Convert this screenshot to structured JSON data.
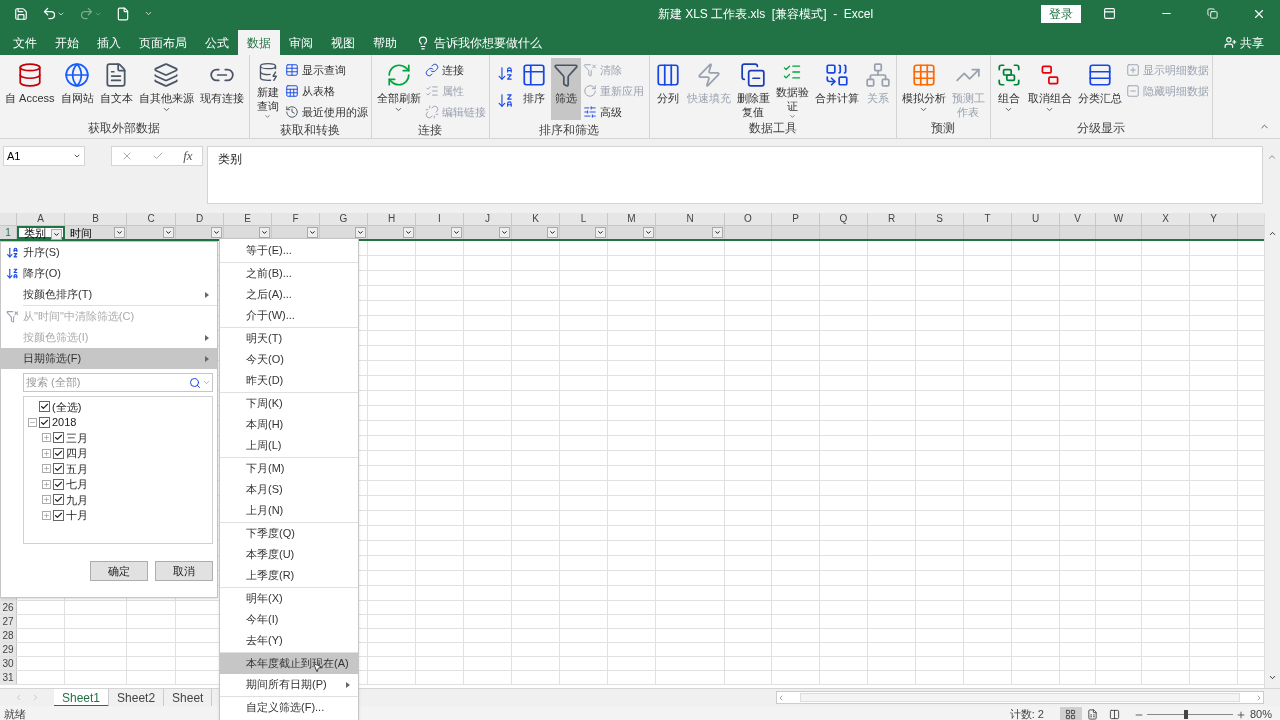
{
  "title_bar": {
    "title": "新建 XLS 工作表.xls  [兼容模式]  -  Excel",
    "sign_in": "登录"
  },
  "menu_tabs": [
    {
      "label": "文件",
      "selected": false
    },
    {
      "label": "开始",
      "selected": false
    },
    {
      "label": "插入",
      "selected": false
    },
    {
      "label": "页面布局",
      "selected": false
    },
    {
      "label": "公式",
      "selected": false
    },
    {
      "label": "数据",
      "selected": true
    },
    {
      "label": "审阅",
      "selected": false
    },
    {
      "label": "视图",
      "selected": false
    },
    {
      "label": "帮助",
      "selected": false
    }
  ],
  "tell_me": "告诉我你想要做什么",
  "share": "共享",
  "ribbon": [
    {
      "label": "获取外部数据",
      "items": [
        {
          "kind": "large",
          "label": "自 Access",
          "disabled": false,
          "caret": false
        },
        {
          "kind": "large",
          "label": "自网站",
          "disabled": false,
          "caret": false
        },
        {
          "kind": "large",
          "label": "自文本",
          "disabled": false,
          "caret": false
        },
        {
          "kind": "large",
          "label": "自其他来源",
          "disabled": false,
          "caret": true
        },
        {
          "kind": "large",
          "label": "现有连接",
          "disabled": false,
          "caret": false
        }
      ]
    },
    {
      "label": "获取和转换",
      "items": [
        {
          "kind": "large",
          "label": "新建查询",
          "disabled": false,
          "caret": true
        },
        {
          "kind": "small",
          "label": "显示查询",
          "disabled": false
        },
        {
          "kind": "small",
          "label": "从表格",
          "disabled": false
        },
        {
          "kind": "small",
          "label": "最近使用的源",
          "disabled": false
        }
      ]
    },
    {
      "label": "连接",
      "items": [
        {
          "kind": "large",
          "label": "全部刷新",
          "disabled": false,
          "caret": true
        },
        {
          "kind": "small",
          "label": "连接",
          "disabled": false
        },
        {
          "kind": "small",
          "label": "属性",
          "disabled": true
        },
        {
          "kind": "small",
          "label": "编辑链接",
          "disabled": true
        }
      ]
    },
    {
      "label": "排序和筛选",
      "items": [
        {
          "kind": "icon",
          "disabled": false
        },
        {
          "kind": "icon",
          "disabled": false
        },
        {
          "kind": "large",
          "label": "排序",
          "disabled": false,
          "caret": false,
          "selected": false
        },
        {
          "kind": "large",
          "label": "筛选",
          "disabled": false,
          "caret": false,
          "selected": true
        },
        {
          "kind": "small",
          "label": "清除",
          "disabled": true
        },
        {
          "kind": "small",
          "label": "重新应用",
          "disabled": true
        },
        {
          "kind": "small",
          "label": "高级",
          "disabled": false
        }
      ]
    },
    {
      "label": "数据工具",
      "items": [
        {
          "kind": "large",
          "label": "分列",
          "disabled": false,
          "caret": false
        },
        {
          "kind": "large",
          "label": "快速填充",
          "disabled": true,
          "caret": false
        },
        {
          "kind": "large",
          "label": "删除重复值",
          "disabled": false,
          "caret": false
        },
        {
          "kind": "large",
          "label": "数据验证",
          "disabled": false,
          "caret": true
        },
        {
          "kind": "large",
          "label": "合并计算",
          "disabled": false,
          "caret": false
        },
        {
          "kind": "large",
          "label": "关系",
          "disabled": true,
          "caret": false
        }
      ]
    },
    {
      "label": "预测",
      "items": [
        {
          "kind": "large",
          "label": "模拟分析",
          "disabled": false,
          "caret": true
        },
        {
          "kind": "large",
          "label": "预测工作表",
          "disabled": true,
          "caret": false
        }
      ]
    },
    {
      "label": "分级显示",
      "items": [
        {
          "kind": "large",
          "label": "组合",
          "disabled": false,
          "caret": true
        },
        {
          "kind": "large",
          "label": "取消组合",
          "disabled": false,
          "caret": true
        },
        {
          "kind": "large",
          "label": "分类汇总",
          "disabled": false,
          "caret": false
        },
        {
          "kind": "small",
          "label": "显示明细数据",
          "disabled": true
        },
        {
          "kind": "small",
          "label": "隐藏明细数据",
          "disabled": true
        }
      ]
    }
  ],
  "formula_bar": {
    "name_box": "A1",
    "function_label": "fx",
    "content": "类别"
  },
  "columns": [
    {
      "letter": "A",
      "filter": true
    },
    {
      "letter": "B",
      "filter": true
    },
    {
      "letter": "C",
      "filter": true
    },
    {
      "letter": "D",
      "filter": true
    },
    {
      "letter": "E",
      "filter": true
    },
    {
      "letter": "F",
      "filter": true
    },
    {
      "letter": "G",
      "filter": true
    },
    {
      "letter": "H",
      "filter": true
    },
    {
      "letter": "I",
      "filter": true
    },
    {
      "letter": "J",
      "filter": true
    },
    {
      "letter": "K",
      "filter": true
    },
    {
      "letter": "L",
      "filter": true
    },
    {
      "letter": "M",
      "filter": true
    },
    {
      "letter": "N",
      "filter": true
    },
    {
      "letter": "O",
      "filter": false
    },
    {
      "letter": "P",
      "filter": false
    },
    {
      "letter": "Q",
      "filter": false
    },
    {
      "letter": "R",
      "filter": false
    },
    {
      "letter": "S",
      "filter": false
    },
    {
      "letter": "T",
      "filter": false
    },
    {
      "letter": "U",
      "filter": false
    },
    {
      "letter": "V",
      "filter": false
    },
    {
      "letter": "W",
      "filter": false
    },
    {
      "letter": "X",
      "filter": false
    },
    {
      "letter": "Y",
      "filter": false
    }
  ],
  "first_row": {
    "number": "1",
    "cells": [
      "类别",
      "时间"
    ]
  },
  "bottom_rows": [
    "26",
    "27",
    "28",
    "29",
    "30",
    "31"
  ],
  "filter_menu": {
    "item_groups": [
      [
        {
          "kind": "ascending",
          "label": "升序(S)",
          "disabled": false,
          "highlighted": false,
          "submenu": false
        },
        {
          "kind": "descending",
          "label": "降序(O)",
          "disabled": false,
          "highlighted": false,
          "submenu": false
        },
        {
          "kind": "plain",
          "label": "按颜色排序(T)",
          "disabled": false,
          "highlighted": false,
          "submenu": true
        }
      ],
      [
        {
          "kind": "clear",
          "label": "从\"时间\"中清除筛选(C)",
          "disabled": true,
          "highlighted": false,
          "submenu": false
        },
        {
          "kind": "plain",
          "label": "按颜色筛选(I)",
          "disabled": true,
          "highlighted": false,
          "submenu": true
        },
        {
          "kind": "plain",
          "label": "日期筛选(F)",
          "disabled": false,
          "highlighted": true,
          "submenu": true
        }
      ]
    ],
    "search": {
      "placeholder": "搜索 (全部)"
    },
    "tree": [
      {
        "label": "(全选)",
        "checked": true
      },
      {
        "label": "2018",
        "checked": true,
        "expanded": true,
        "children": [
          {
            "label": "三月",
            "checked": true,
            "expanded": false
          },
          {
            "label": "四月",
            "checked": true,
            "expanded": false
          },
          {
            "label": "五月",
            "checked": true,
            "expanded": false
          },
          {
            "label": "七月",
            "checked": true,
            "expanded": false
          },
          {
            "label": "九月",
            "checked": true,
            "expanded": false
          },
          {
            "label": "十月",
            "checked": true,
            "expanded": false
          }
        ]
      }
    ],
    "buttons": [
      "确定",
      "取消"
    ]
  },
  "date_submenu": [
    [
      {
        "label": "等于(E)...",
        "selected": false,
        "submenu": false
      }
    ],
    [
      {
        "label": "之前(B)...",
        "selected": false,
        "submenu": false
      },
      {
        "label": "之后(A)...",
        "selected": false,
        "submenu": false
      },
      {
        "label": "介于(W)...",
        "selected": false,
        "submenu": false
      }
    ],
    [
      {
        "label": "明天(T)",
        "selected": false,
        "submenu": false
      },
      {
        "label": "今天(O)",
        "selected": false,
        "submenu": false
      },
      {
        "label": "昨天(D)",
        "selected": false,
        "submenu": false
      }
    ],
    [
      {
        "label": "下周(K)",
        "selected": false,
        "submenu": false
      },
      {
        "label": "本周(H)",
        "selected": false,
        "submenu": false
      },
      {
        "label": "上周(L)",
        "selected": false,
        "submenu": false
      }
    ],
    [
      {
        "label": "下月(M)",
        "selected": false,
        "submenu": false
      },
      {
        "label": "本月(S)",
        "selected": false,
        "submenu": false
      },
      {
        "label": "上月(N)",
        "selected": false,
        "submenu": false
      }
    ],
    [
      {
        "label": "下季度(Q)",
        "selected": false,
        "submenu": false
      },
      {
        "label": "本季度(U)",
        "selected": false,
        "submenu": false
      },
      {
        "label": "上季度(R)",
        "selected": false,
        "submenu": false
      }
    ],
    [
      {
        "label": "明年(X)",
        "selected": false,
        "submenu": false
      },
      {
        "label": "今年(I)",
        "selected": false,
        "submenu": false
      },
      {
        "label": "去年(Y)",
        "selected": false,
        "submenu": false
      }
    ],
    [
      {
        "label": "本年度截止到现在(A)",
        "selected": true,
        "submenu": false
      },
      {
        "label": "期间所有日期(P)",
        "selected": false,
        "submenu": true
      }
    ],
    [
      {
        "label": "自定义筛选(F)...",
        "selected": false,
        "submenu": false
      }
    ]
  ],
  "sheet_tabs": [
    {
      "label": "Sheet1",
      "selected": true
    },
    {
      "label": "Sheet2",
      "selected": false
    },
    {
      "label": "Sheet",
      "selected": false
    }
  ],
  "status_bar": {
    "ready": "就绪",
    "count": "计数: 2",
    "views": [
      {
        "selected": true
      },
      {
        "selected": false
      },
      {
        "selected": false
      }
    ],
    "zoom": {
      "level": 0.45,
      "reading": "80%"
    }
  }
}
